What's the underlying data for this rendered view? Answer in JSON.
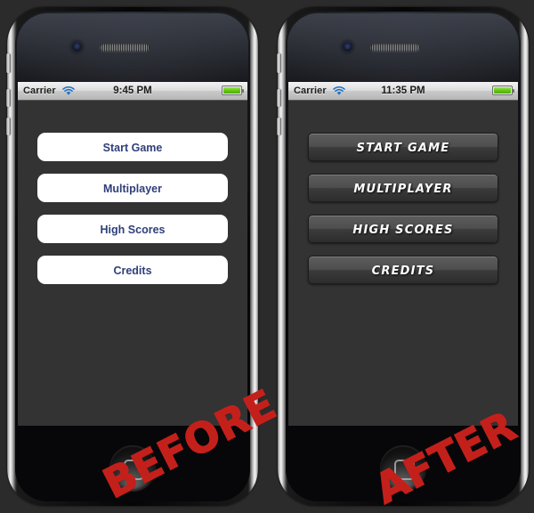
{
  "page": {
    "background_color": "#2b2b2b",
    "accent_stamp_color": "#c4201b"
  },
  "phones": [
    {
      "id": "before",
      "stamp_label": "BEFORE",
      "status_bar": {
        "carrier": "Carrier",
        "wifi_icon": "wifi-icon",
        "time": "9:45 PM",
        "battery_icon": "battery-full-icon",
        "battery_color": "#61c318"
      },
      "hardware": {
        "camera_icon": "front-camera-icon",
        "speaker_icon": "earpiece-speaker-icon",
        "home_button_icon": "home-button-icon",
        "mute_switch_icon": "mute-switch-icon",
        "volume_up_icon": "volume-up-button-icon",
        "volume_down_icon": "volume-down-button-icon"
      },
      "screen": {
        "background_color": "#333333",
        "button_style": "plain-white",
        "button_text_color": "#2f3f7a",
        "buttons": [
          {
            "label": "Start Game"
          },
          {
            "label": "Multiplayer"
          },
          {
            "label": "High Scores"
          },
          {
            "label": "Credits"
          }
        ]
      }
    },
    {
      "id": "after",
      "stamp_label": "AFTER",
      "status_bar": {
        "carrier": "Carrier",
        "wifi_icon": "wifi-icon",
        "time": "11:35 PM",
        "battery_icon": "battery-full-icon",
        "battery_color": "#61c318"
      },
      "hardware": {
        "camera_icon": "front-camera-icon",
        "speaker_icon": "earpiece-speaker-icon",
        "home_button_icon": "home-button-icon",
        "mute_switch_icon": "mute-switch-icon",
        "volume_up_icon": "volume-up-button-icon",
        "volume_down_icon": "volume-down-button-icon"
      },
      "screen": {
        "background_color": "#333333",
        "button_style": "dark-gradient-italic",
        "button_text_color": "#ffffff",
        "buttons": [
          {
            "label": "START GAME"
          },
          {
            "label": "MULTIPLAYER"
          },
          {
            "label": "HIGH SCORES"
          },
          {
            "label": "CREDITS"
          }
        ]
      }
    }
  ]
}
